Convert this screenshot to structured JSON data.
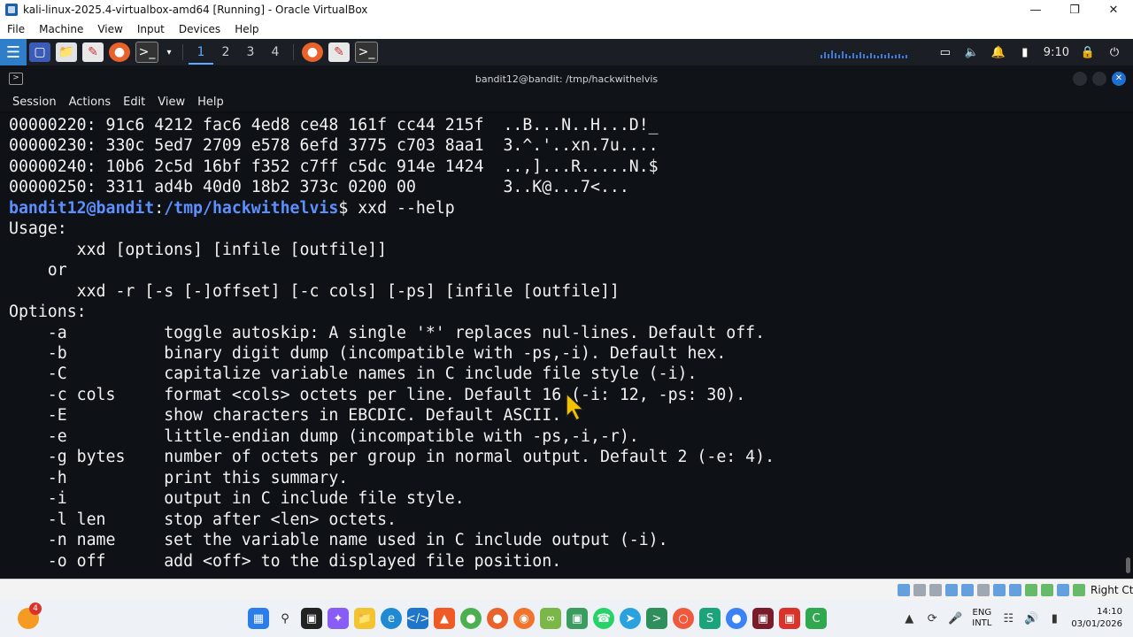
{
  "window": {
    "title": "kali-linux-2025.4-virtualbox-amd64 [Running] - Oracle VirtualBox",
    "minimize": "—",
    "maximize": "❐",
    "close": "✕"
  },
  "vbox_menu": [
    "File",
    "Machine",
    "View",
    "Input",
    "Devices",
    "Help"
  ],
  "kali_panel": {
    "workspaces": [
      "1",
      "2",
      "3",
      "4"
    ],
    "active_workspace": "1",
    "clock": "9:10"
  },
  "terminal": {
    "title": "bandit12@bandit: /tmp/hackwithelvis",
    "menu": [
      "Session",
      "Actions",
      "Edit",
      "View",
      "Help"
    ],
    "prompt_user": "bandit12@bandit",
    "prompt_colon": ":",
    "prompt_path": "/tmp/hackwithelvis",
    "prompt_dollar": "$ ",
    "command": "xxd --help",
    "hexdump_lines": [
      "00000220: 91c6 4212 fac6 4ed8 ce48 161f cc44 215f  ..B...N..H...D!_",
      "00000230: 330c 5ed7 2709 e578 6efd 3775 c703 8aa1  3.^.'..xn.7u....",
      "00000240: 10b6 2c5d 16bf f352 c7ff c5dc 914e 1424  ..,]...R.....N.$",
      "00000250: 3311 ad4b 40d0 18b2 373c 0200 00         3..K@...7<..."
    ],
    "output_lines": [
      "Usage:",
      "       xxd [options] [infile [outfile]]",
      "    or",
      "       xxd -r [-s [-]offset] [-c cols] [-ps] [infile [outfile]]",
      "Options:",
      "    -a          toggle autoskip: A single '*' replaces nul-lines. Default off.",
      "    -b          binary digit dump (incompatible with -ps,-i). Default hex.",
      "    -C          capitalize variable names in C include file style (-i).",
      "    -c cols     format <cols> octets per line. Default 16 (-i: 12, -ps: 30).",
      "    -E          show characters in EBCDIC. Default ASCII.",
      "    -e          little-endian dump (incompatible with -ps,-i,-r).",
      "    -g bytes    number of octets per group in normal output. Default 2 (-e: 4).",
      "    -h          print this summary.",
      "    -i          output in C include file style.",
      "    -l len      stop after <len> octets.",
      "    -n name     set the variable name used in C include output (-i).",
      "    -o off      add <off> to the displayed file position."
    ]
  },
  "vbox_status": {
    "host_key": "Right Ctrl"
  },
  "taskbar": {
    "weather_badge": "4",
    "lang_top": "ENG",
    "lang_bottom": "INTL",
    "time": "14:10",
    "date": "03/01/2026"
  },
  "colors": {
    "terminal_bg": "#0e1116",
    "prompt_blue": "#5d8fff",
    "kali_accent": "#2f7ec9"
  }
}
